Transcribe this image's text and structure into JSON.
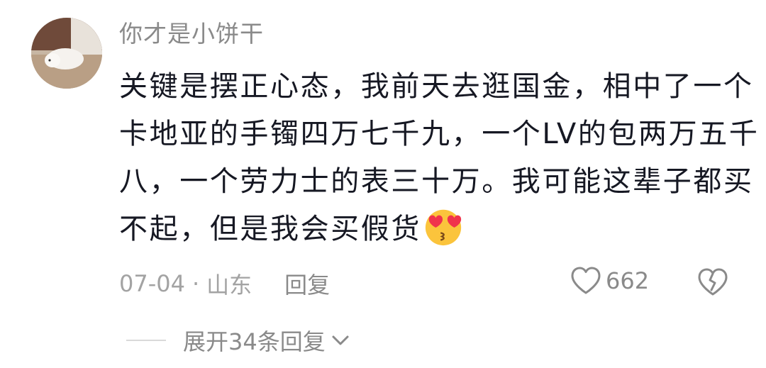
{
  "comment": {
    "username": "你才是小饼干",
    "lines": [
      "关键是摆正心态，我前天去逛国金，相中了一个",
      "卡地亚的手镯四万七千九，一个LV的包两万五千",
      "八，一个劳力士的表三十万。我可能这辈子都买",
      "不起，但是我会买假货"
    ],
    "emoji": "heart-eyes-kiss-emoji",
    "date": "07-04",
    "separator": "·",
    "location": "山东",
    "reply_label": "回复",
    "like_count": "662",
    "expand_label": "展开34条回复"
  },
  "colors": {
    "text": "#161823",
    "secondary": "#8a8a8a",
    "emoji_face": "#fbc43c",
    "heart": "#f0344c"
  },
  "icons": {
    "like": "heart-outline-icon",
    "dislike": "broken-heart-icon",
    "expand": "chevron-down-icon"
  }
}
